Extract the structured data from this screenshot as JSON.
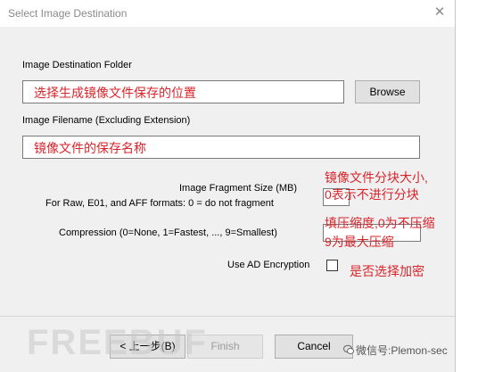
{
  "window": {
    "title": "Select Image Destination",
    "close_glyph": "✕"
  },
  "fields": {
    "dest_folder_label": "Image Destination Folder",
    "dest_folder_value": "选择生成镜像文件保存的位置",
    "browse_label": "Browse",
    "filename_label": "Image Filename (Excluding Extension)",
    "filename_value": "镜像文件的保存名称",
    "fragment_label": "Image Fragment Size (MB)",
    "fragment_note": "For Raw, E01, and AFF formats: 0 = do not fragment",
    "compression_label": "Compression (0=None, 1=Fastest, ..., 9=Smallest)",
    "encryption_label": "Use AD Encryption",
    "encryption_checked": false
  },
  "annotations": {
    "fragment_line1": "镜像文件分块大小,",
    "fragment_line2": "0表示不进行分块",
    "compression_line1": "填压缩度,0为不压缩",
    "compression_line2": "9为最大压缩",
    "encryption": "是否选择加密"
  },
  "buttons": {
    "back": "< 上一步(B)",
    "finish": "Finish",
    "cancel": "Cancel"
  },
  "watermark": {
    "text": "FREEBUF",
    "wechat": "微信号:Plemon-sec"
  },
  "icons": {
    "close": "close-icon",
    "checkbox": "checkbox-icon",
    "wechat": "wechat-icon"
  },
  "colors": {
    "annotation": "#d8242b",
    "dialog_bg": "#f0f0f0"
  }
}
